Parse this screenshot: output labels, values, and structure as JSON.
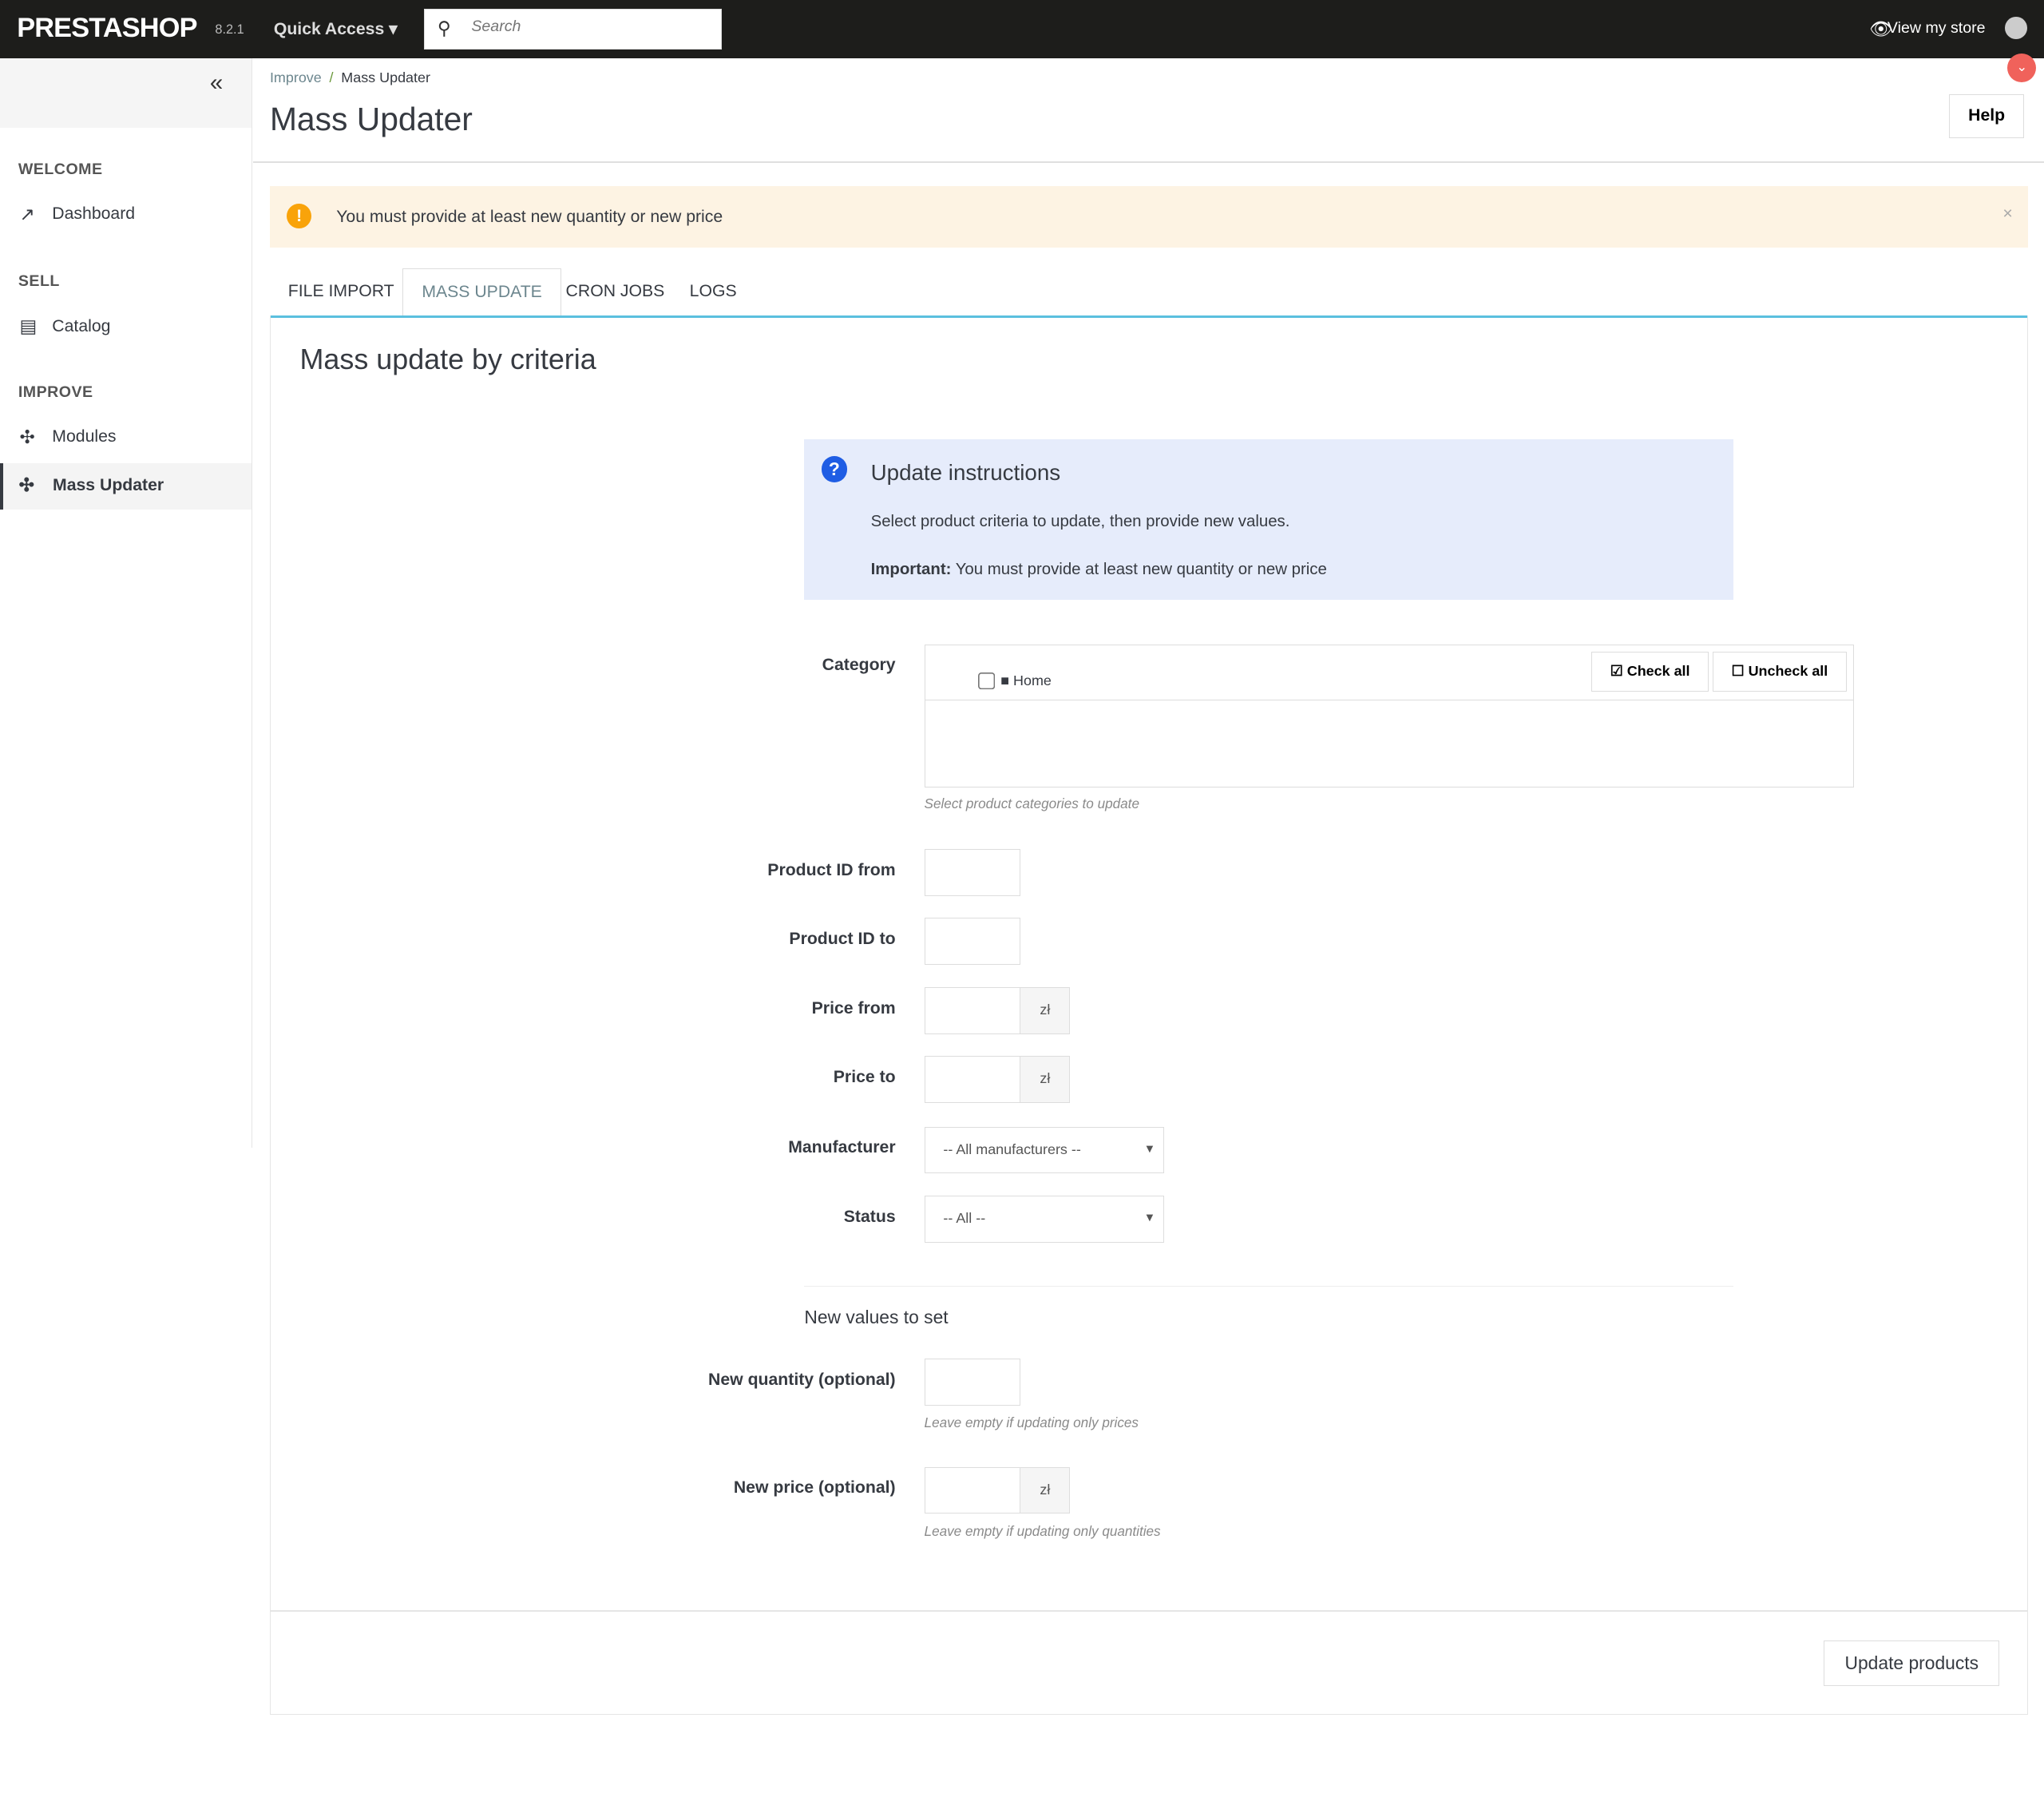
{
  "topbar": {
    "logo": "PRESTASHOP",
    "version": "8.2.1",
    "quick_access": "Quick Access",
    "search_placeholder": "Search",
    "view_store": "View my store"
  },
  "sidebar": {
    "sections": [
      {
        "title": "WELCOME",
        "items": [
          {
            "label": "Dashboard",
            "icon": "trending-up-icon"
          }
        ]
      },
      {
        "title": "SELL",
        "items": [
          {
            "label": "Catalog",
            "icon": "store-icon"
          }
        ]
      },
      {
        "title": "IMPROVE",
        "items": [
          {
            "label": "Modules",
            "icon": "puzzle-icon"
          },
          {
            "label": "Mass Updater",
            "icon": "puzzle-icon",
            "active": true
          }
        ]
      }
    ]
  },
  "breadcrumb": {
    "parent": "Improve",
    "current": "Mass Updater"
  },
  "page_title": "Mass Updater",
  "help_label": "Help",
  "alert": {
    "message": "You must provide at least new quantity or new price",
    "close": "×",
    "color": "#f9a30a"
  },
  "tabs": [
    "FILE IMPORT",
    "MASS UPDATE",
    "CRON JOBS",
    "LOGS"
  ],
  "active_tab": "MASS UPDATE",
  "panel_title": "Mass update by criteria",
  "instructions": {
    "title": "Update instructions",
    "line1": "Select product criteria to update, then provide new values.",
    "important_label": "Important:",
    "important_text": " You must provide at least new quantity or new price"
  },
  "form": {
    "category_label": "Category",
    "check_all": "Check all",
    "uncheck_all": "Uncheck all",
    "home": "Home",
    "category_hint": "Select product categories to update",
    "id_from": "Product ID from",
    "id_to": "Product ID to",
    "price_from": "Price from",
    "price_to": "Price to",
    "currency": "zł",
    "manufacturer": "Manufacturer",
    "manufacturer_value": "-- All manufacturers --",
    "status": "Status",
    "status_value": "-- All --",
    "new_values": "New values to set",
    "new_qty": "New quantity (optional)",
    "new_qty_hint": "Leave empty if updating only prices",
    "new_price": "New price (optional)",
    "new_price_hint": "Leave empty if updating only quantities"
  },
  "submit_label": "Update products"
}
